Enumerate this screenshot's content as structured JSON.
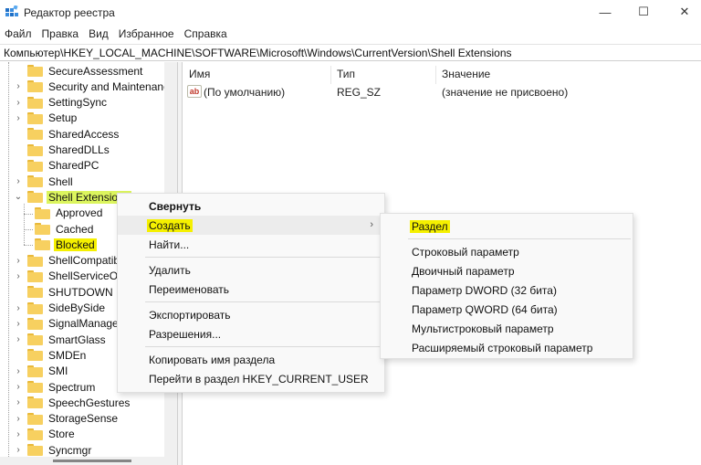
{
  "window": {
    "title": "Редактор реестра",
    "controls": {
      "minimize": "—",
      "maximize": "☐",
      "close": "✕"
    }
  },
  "menubar": [
    "Файл",
    "Правка",
    "Вид",
    "Избранное",
    "Справка"
  ],
  "address": "Компьютер\\HKEY_LOCAL_MACHINE\\SOFTWARE\\Microsoft\\Windows\\CurrentVersion\\Shell Extensions",
  "tree": {
    "items": [
      {
        "label": "SecureAssessment",
        "expander": "",
        "level": 0
      },
      {
        "label": "Security and Maintenance",
        "expander": "›",
        "level": 0
      },
      {
        "label": "SettingSync",
        "expander": "›",
        "level": 0
      },
      {
        "label": "Setup",
        "expander": "›",
        "level": 0
      },
      {
        "label": "SharedAccess",
        "expander": "",
        "level": 0
      },
      {
        "label": "SharedDLLs",
        "expander": "",
        "level": 0
      },
      {
        "label": "SharedPC",
        "expander": "",
        "level": 0
      },
      {
        "label": "Shell",
        "expander": "›",
        "level": 0
      },
      {
        "label": "Shell Extensions",
        "expander": "⌄",
        "level": 0,
        "highlight": "green"
      },
      {
        "label": "Approved",
        "expander": "",
        "level": 1
      },
      {
        "label": "Cached",
        "expander": "",
        "level": 1
      },
      {
        "label": "Blocked",
        "expander": "",
        "level": 1,
        "highlight": "yellow"
      },
      {
        "label": "ShellCompatibility",
        "expander": "›",
        "level": 0
      },
      {
        "label": "ShellServiceObjects",
        "expander": "›",
        "level": 0
      },
      {
        "label": "SHUTDOWN",
        "expander": "",
        "level": 0
      },
      {
        "label": "SideBySide",
        "expander": "›",
        "level": 0
      },
      {
        "label": "SignalManager",
        "expander": "›",
        "level": 0
      },
      {
        "label": "SmartGlass",
        "expander": "›",
        "level": 0
      },
      {
        "label": "SMDEn",
        "expander": "",
        "level": 0
      },
      {
        "label": "SMI",
        "expander": "›",
        "level": 0
      },
      {
        "label": "Spectrum",
        "expander": "›",
        "level": 0
      },
      {
        "label": "SpeechGestures",
        "expander": "›",
        "level": 0
      },
      {
        "label": "StorageSense",
        "expander": "›",
        "level": 0
      },
      {
        "label": "Store",
        "expander": "›",
        "level": 0
      },
      {
        "label": "Syncmgr",
        "expander": "›",
        "level": 0
      }
    ]
  },
  "list": {
    "columns": [
      "Имя",
      "Тип",
      "Значение"
    ],
    "rows": [
      {
        "icon": "ab",
        "name": "(По умолчанию)",
        "type": "REG_SZ",
        "value": "(значение не присвоено)"
      }
    ]
  },
  "context_menu": {
    "items": [
      {
        "label": "Свернуть",
        "bold": true
      },
      {
        "label": "Создать",
        "submenu": true,
        "active": true,
        "highlight": true,
        "arrow": "›"
      },
      {
        "label": "Найти..."
      },
      {
        "separator": true
      },
      {
        "label": "Удалить"
      },
      {
        "label": "Переименовать"
      },
      {
        "separator": true
      },
      {
        "label": "Экспортировать"
      },
      {
        "label": "Разрешения..."
      },
      {
        "separator": true
      },
      {
        "label": "Копировать имя раздела"
      },
      {
        "label": "Перейти в раздел HKEY_CURRENT_USER"
      }
    ]
  },
  "submenu": {
    "items": [
      {
        "label": "Раздел",
        "highlight": true
      },
      {
        "separator": true
      },
      {
        "label": "Строковый параметр"
      },
      {
        "label": "Двоичный параметр"
      },
      {
        "label": "Параметр DWORD (32 бита)"
      },
      {
        "label": "Параметр QWORD (64 бита)"
      },
      {
        "label": "Мультистроковый параметр"
      },
      {
        "label": "Расширяемый строковый параметр"
      }
    ]
  },
  "colors": {
    "highlight_yellow": "#f5f000",
    "highlight_green": "#dcf55e",
    "folder": "#f7d060"
  }
}
